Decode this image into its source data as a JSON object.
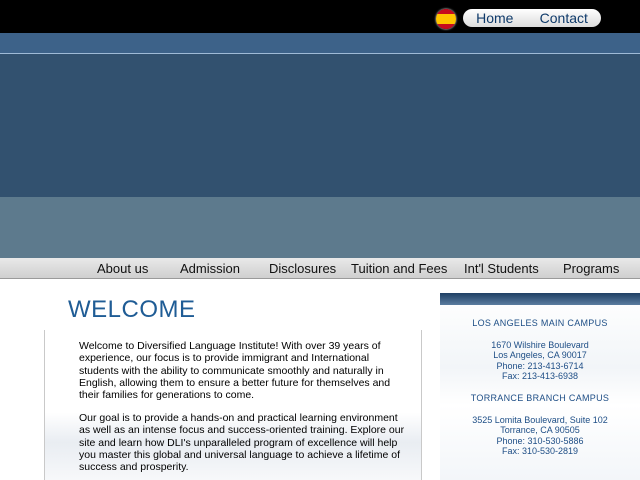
{
  "topbar": {
    "flag_label": "Spanish",
    "home_label": "Home",
    "contact_label": "Contact"
  },
  "nav": {
    "items": [
      "About us",
      "Admission",
      "Disclosures",
      "Tuition and Fees",
      "Int'l Students",
      "Programs"
    ]
  },
  "main": {
    "title": "WELCOME",
    "paragraphs": [
      "Welcome to Diversified Language Institute! With over 39 years of experience, our focus is to provide immigrant and International students with the ability to communicate smoothly and naturally in English, allowing them to ensure a better future for themselves and their families for generations to come.",
      "Our goal is to provide a hands-on and practical learning environment as well as an intense focus and success-oriented training. Explore our site and learn how DLI's unparalleled program of excellence will help you master this global and universal language to achieve a lifetime of success and prosperity."
    ]
  },
  "sidebar": {
    "campuses": [
      {
        "title": "LOS ANGELES  MAIN CAMPUS",
        "lines": [
          "1670 Wilshire Boulevard",
          "Los Angeles, CA 90017",
          "Phone:  213-413-6714",
          "Fax:  213-413-6938"
        ]
      },
      {
        "title": "TORRANCE BRANCH CAMPUS",
        "lines": [
          "3525 Lomita Boulevard, Suite 102",
          "Torrance, CA 90505",
          "Phone:  310-530-5886",
          "Fax:  310-530-2819"
        ]
      }
    ]
  },
  "colors": {
    "header_bg": "#000000",
    "hero_bg": "#32516f",
    "hero_lower_bg": "#5d7a8d",
    "accent_title": "#1f5c95",
    "campus_text": "#1e4e86"
  }
}
